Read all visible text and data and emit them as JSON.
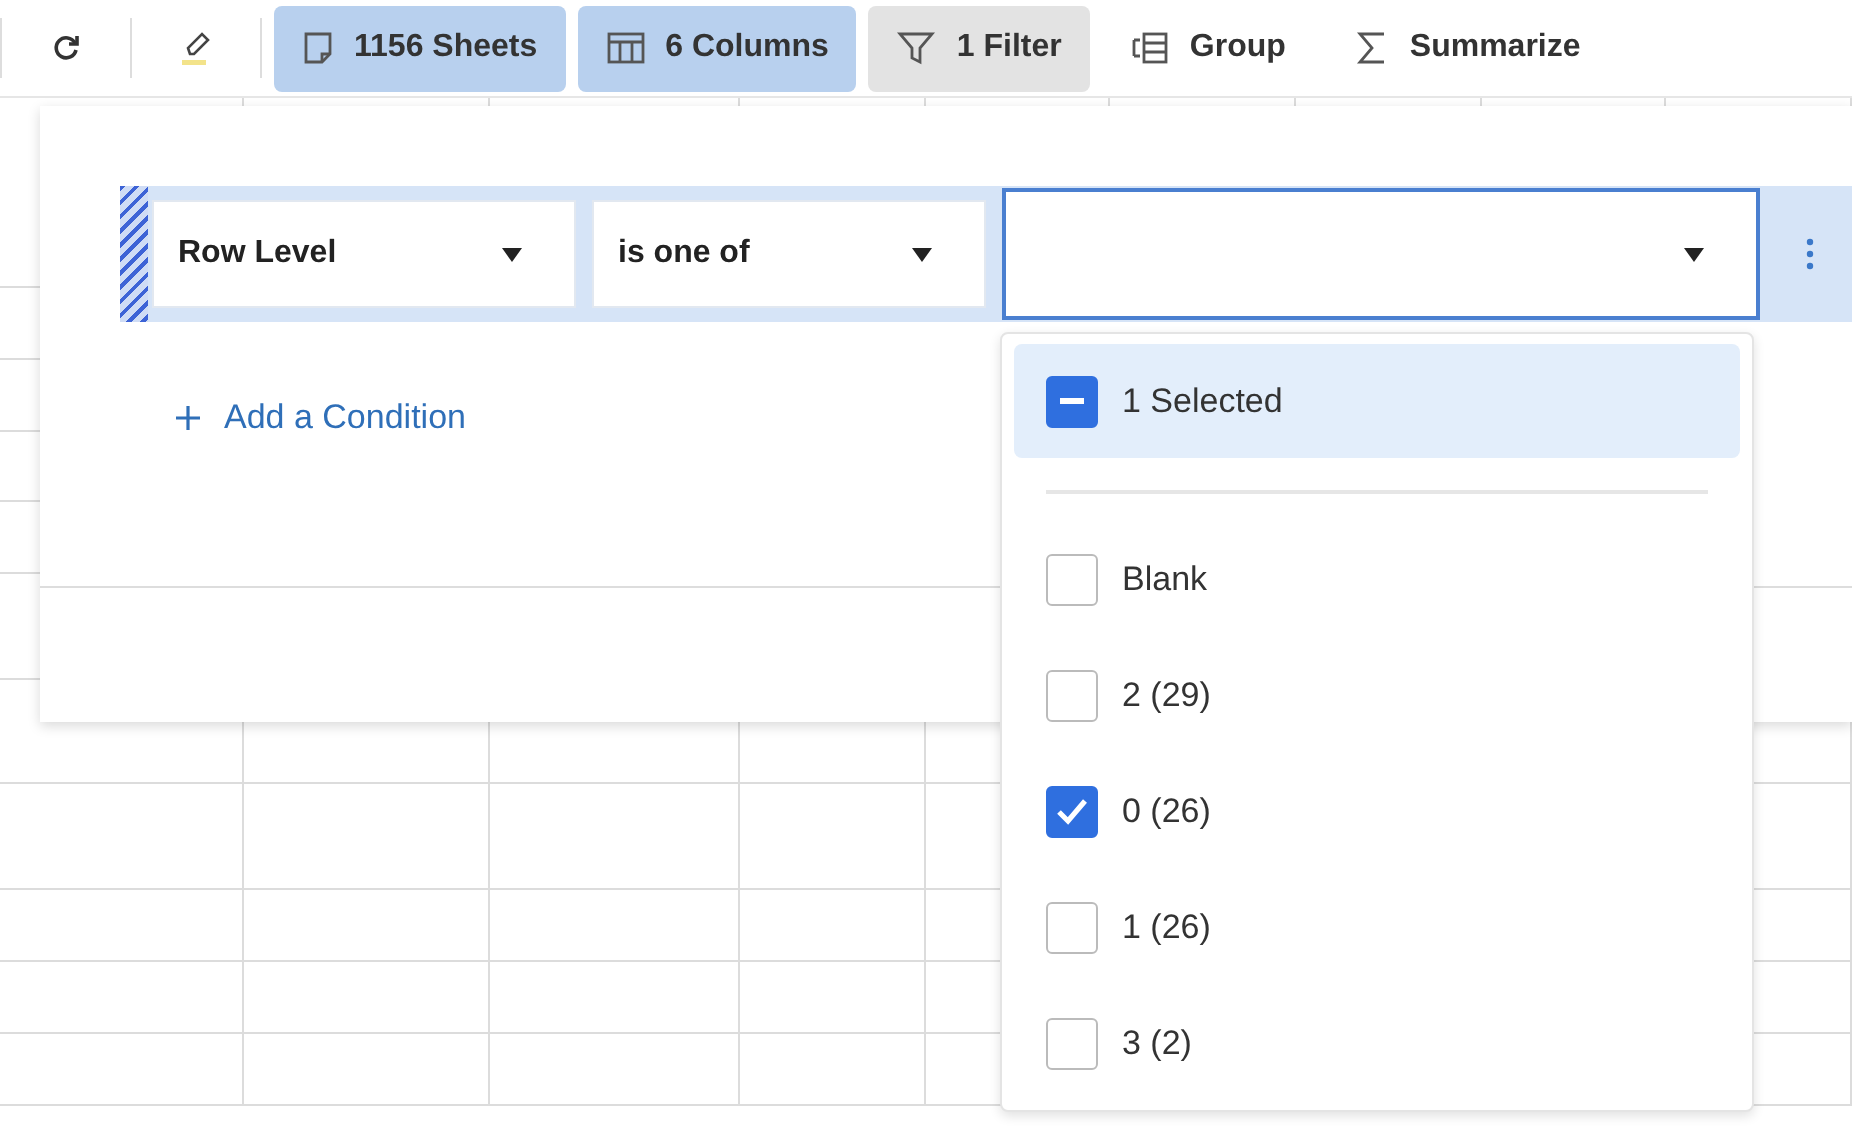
{
  "toolbar": {
    "tools": [
      {
        "kind": "refresh"
      },
      {
        "kind": "highlighter"
      }
    ],
    "buttons": [
      {
        "kind": "sheets",
        "label": "1156 Sheets",
        "selected": true
      },
      {
        "kind": "columns",
        "label": "6 Columns",
        "selected": true
      },
      {
        "kind": "filter",
        "label": "1 Filter",
        "selected": true
      },
      {
        "kind": "group",
        "label": "Group",
        "selected": false
      },
      {
        "kind": "summarize",
        "label": "Summarize",
        "selected": false
      }
    ]
  },
  "filter_panel": {
    "condition": {
      "field": "Row Level",
      "operator": "is one of"
    },
    "add_condition": "Add a Condition"
  },
  "value_dropdown": {
    "summary": "1 Selected",
    "summary_indeterminate": true,
    "options": [
      {
        "label": "Blank",
        "checked": false
      },
      {
        "label": "2 (29)",
        "checked": false
      },
      {
        "label": "0 (26)",
        "checked": true
      },
      {
        "label": "1 (26)",
        "checked": false
      },
      {
        "label": "3 (2)",
        "checked": false
      }
    ]
  }
}
